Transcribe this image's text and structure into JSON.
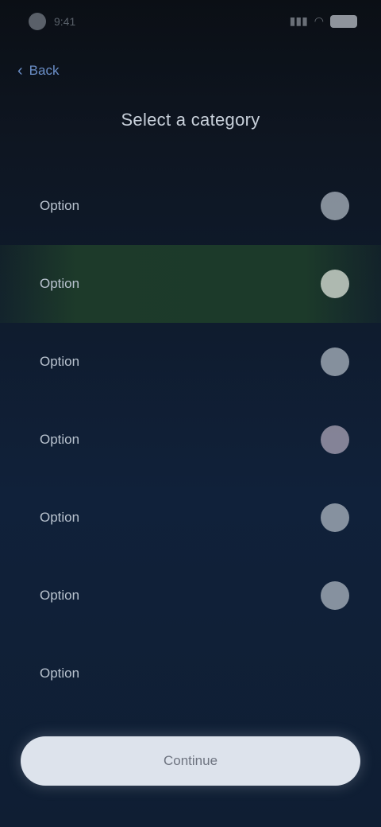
{
  "status_bar": {
    "time": "9:41",
    "icons": [
      "signal-icon",
      "wifi-icon",
      "battery-icon"
    ]
  },
  "back": {
    "label": "Back"
  },
  "title": "Select a category",
  "options": [
    {
      "label": "Option",
      "selected": false
    },
    {
      "label": "Option",
      "selected": true
    },
    {
      "label": "Option",
      "selected": false
    },
    {
      "label": "Option",
      "selected": false
    },
    {
      "label": "Option",
      "selected": false
    },
    {
      "label": "Option",
      "selected": false
    },
    {
      "label": "Option",
      "selected": false
    }
  ],
  "primary_button": {
    "label": "Continue"
  },
  "colors": {
    "background": "#0e1622",
    "selected_row": "#1d3a2a",
    "accent_link": "#6b8fc8",
    "button": "#dde3ec"
  }
}
